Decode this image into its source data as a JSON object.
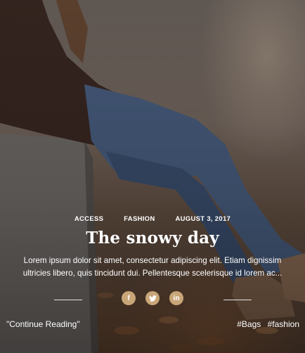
{
  "post": {
    "categories": [
      "ACCESS",
      "FASHION"
    ],
    "date": "AUGUST 3, 2017",
    "title": "The snowy day",
    "excerpt_lines": [
      "Lorem ipsum dolor sit amet, consectetur adipiscing elit. Etiam dignissim",
      "ultricies libero, quis tincidunt dui. Pellentesque scelerisque id lorem ac..."
    ],
    "read_more": "\"Continue Reading\"",
    "tags": [
      "#Bags",
      "#fashion"
    ]
  },
  "share": {
    "accent_color": "#c8a678",
    "facebook": "f",
    "twitter_icon": "twitter-bird",
    "linkedin": "in"
  }
}
